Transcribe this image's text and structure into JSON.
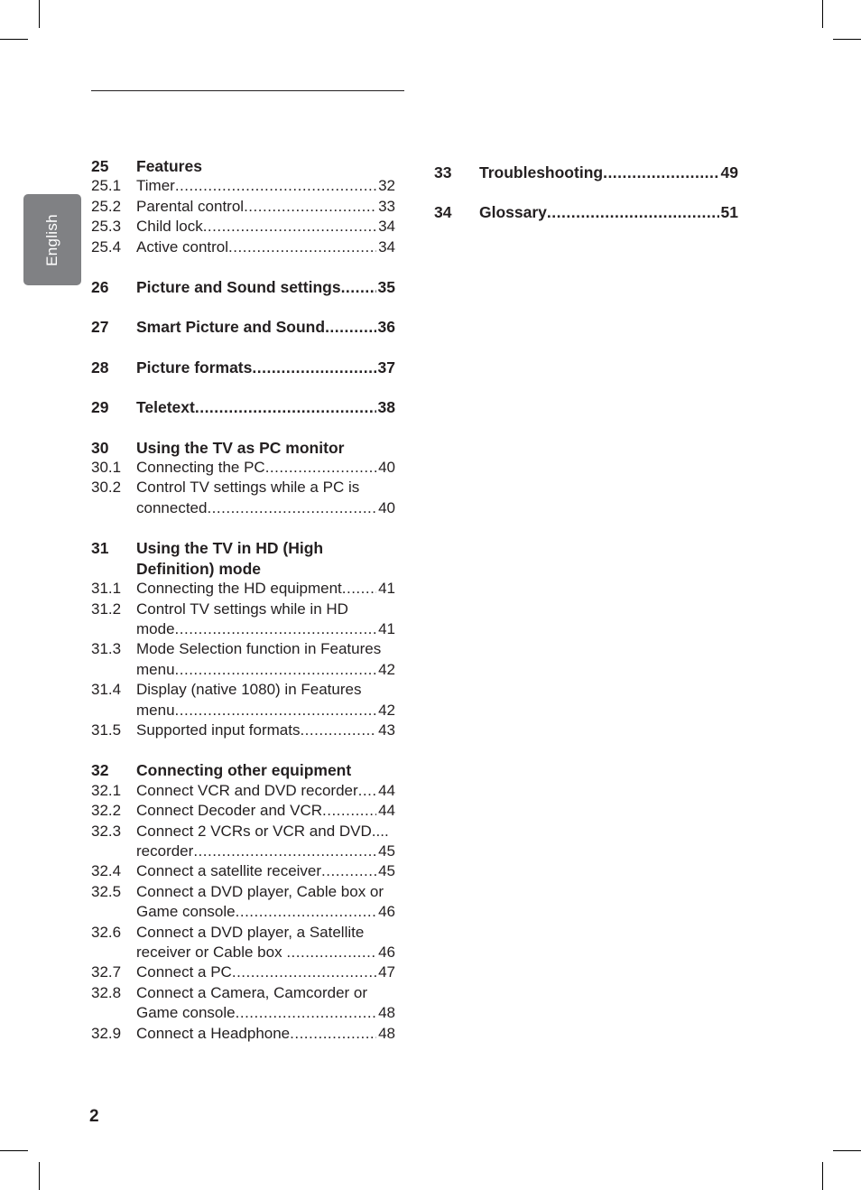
{
  "sidebar": {
    "language_tab": "English"
  },
  "toc_left": {
    "s25": {
      "num": "25",
      "title": "Features",
      "items": [
        {
          "num": "25.1",
          "title": "Timer",
          "page": "32"
        },
        {
          "num": "25.2",
          "title": "Parental control",
          "page": "33"
        },
        {
          "num": "25.3",
          "title": "Child lock",
          "page": "34"
        },
        {
          "num": "25.4",
          "title": "Active control",
          "page": "34"
        }
      ]
    },
    "s26": {
      "num": "26",
      "title": "Picture and Sound settings",
      "page": "35"
    },
    "s27": {
      "num": "27",
      "title": "Smart Picture and Sound",
      "page": "36"
    },
    "s28": {
      "num": "28",
      "title": "Picture formats",
      "page": "37"
    },
    "s29": {
      "num": "29",
      "title": "Teletext",
      "page": "38"
    },
    "s30": {
      "num": "30",
      "title": "Using the TV as PC monitor",
      "items": [
        {
          "num": "30.1",
          "title": "Connecting the PC",
          "page": "40"
        },
        {
          "num": "30.2",
          "title_line1": "Control TV settings while a PC is",
          "title_line2": "connected",
          "page": "40"
        }
      ]
    },
    "s31": {
      "num": "31",
      "title_line1": "Using the TV in HD (High",
      "title_line2": "Definition) mode",
      "items": [
        {
          "num": "31.1",
          "title": "Connecting the HD equipment",
          "page": "41"
        },
        {
          "num": "31.2",
          "title_line1": "Control TV settings while in HD",
          "title_line2": "mode",
          "page": "41"
        },
        {
          "num": "31.3",
          "title_line1": "Mode Selection function in Features",
          "title_line2": "menu",
          "page": "42"
        },
        {
          "num": "31.4",
          "title_line1": "Display (native 1080) in Features",
          "title_line2": "menu",
          "page": "42"
        },
        {
          "num": "31.5",
          "title": "Supported input formats",
          "page": "43"
        }
      ]
    },
    "s32": {
      "num": "32",
      "title": "Connecting other equipment",
      "items": [
        {
          "num": "32.1",
          "title": "Connect VCR and DVD recorder",
          "page": "44"
        },
        {
          "num": "32.2",
          "title": "Connect Decoder and VCR",
          "page": "44"
        },
        {
          "num": "32.3",
          "title_line1": "Connect 2 VCRs or VCR and DVD....",
          "title_line2": "recorder",
          "page": "45"
        },
        {
          "num": "32.4",
          "title": "Connect a satellite receiver",
          "page": "45"
        },
        {
          "num": "32.5",
          "title_line1": "Connect a DVD player, Cable box or",
          "title_line2": "Game console",
          "page": "46"
        },
        {
          "num": "32.6",
          "title_line1": "Connect a DVD player, a Satellite",
          "title_line2": "receiver or Cable box ",
          "page": "46"
        },
        {
          "num": "32.7",
          "title": "Connect a PC",
          "page": "47"
        },
        {
          "num": "32.8",
          "title_line1": "Connect a Camera, Camcorder or",
          "title_line2": "Game console",
          "page": "48"
        },
        {
          "num": "32.9",
          "title": "Connect a Headphone",
          "page": "48"
        }
      ]
    }
  },
  "toc_right": {
    "s33": {
      "num": "33",
      "title": "Troubleshooting",
      "page": "49"
    },
    "s34": {
      "num": "34",
      "title": "Glossary",
      "page": "51"
    }
  },
  "footer": {
    "page_number": "2"
  }
}
